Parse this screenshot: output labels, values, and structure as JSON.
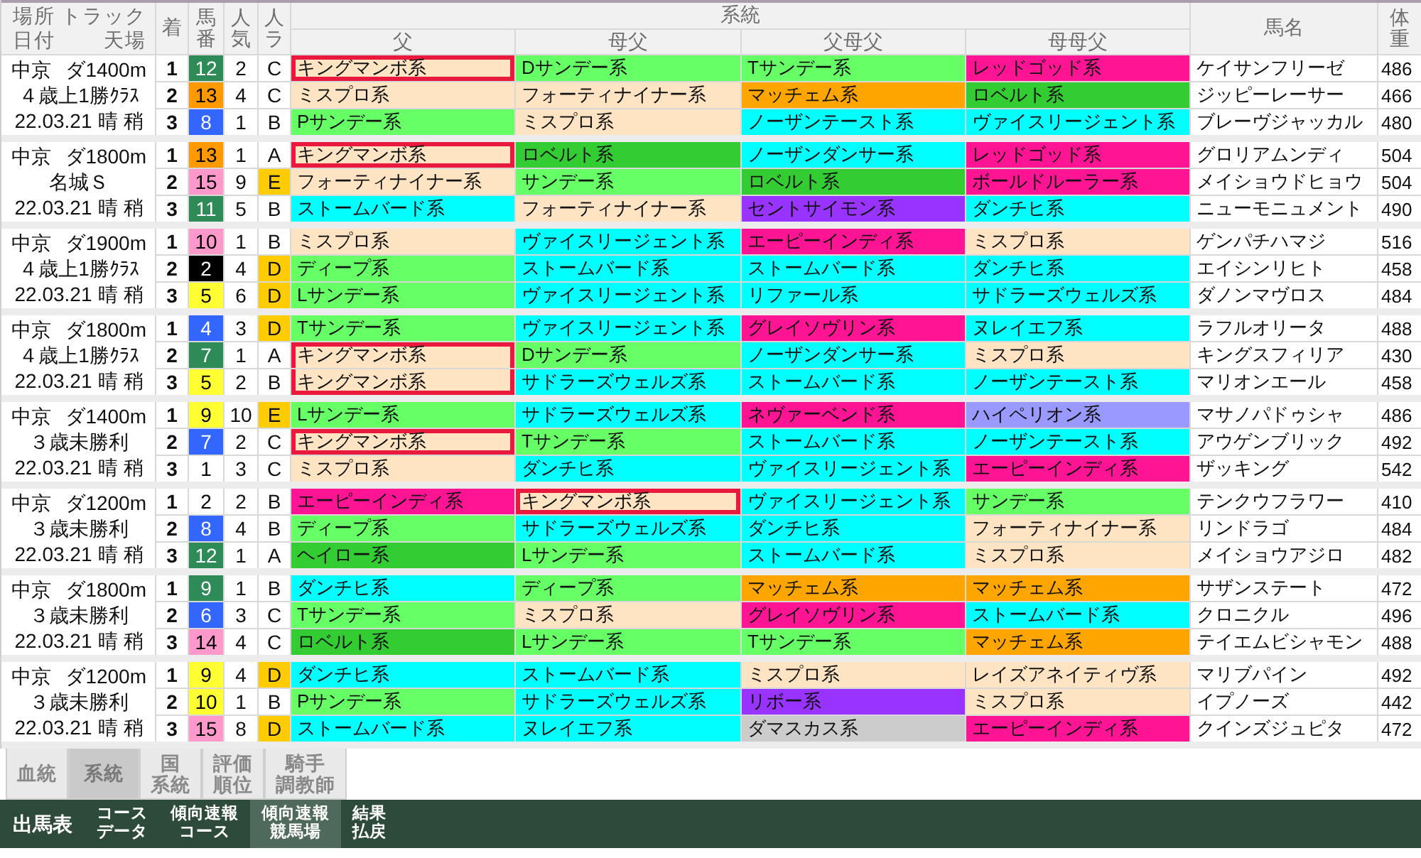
{
  "header": {
    "info_labels": [
      "場所",
      "トラック",
      "日付",
      "天場"
    ],
    "finish": "着",
    "number": "馬番",
    "popularity": "人気",
    "rank": "人ラ",
    "lineage_group": "系統",
    "lineage_columns": [
      "父",
      "母父",
      "父母父",
      "母母父"
    ],
    "horse_name": "馬名",
    "weight": "体重"
  },
  "races": [
    {
      "venue": "中京",
      "track": "ダ1400m",
      "race_name": "４歳上1勝ｸﾗｽ",
      "date": "22.03.21",
      "weather": "晴",
      "going": "稍",
      "horses": [
        {
          "finish": "1",
          "number": {
            "text": "12",
            "color": "#2e8b57"
          },
          "popularity": "2",
          "rank": "C",
          "rank_highlighted": false,
          "lineage": [
            {
              "text": "キングマンボ系",
              "color": "#ffe4c4",
              "marked": true
            },
            {
              "text": "Dサンデー系",
              "color": "#66ff66",
              "marked": false
            },
            {
              "text": "Tサンデー系",
              "color": "#66ff66",
              "marked": false
            },
            {
              "text": "レッドゴッド系",
              "color": "#ff1493",
              "marked": false
            }
          ],
          "name": "ケイサンフリーゼ",
          "weight": "486"
        },
        {
          "finish": "2",
          "number": {
            "text": "13",
            "color": "#ff9900"
          },
          "popularity": "4",
          "rank": "C",
          "rank_highlighted": false,
          "lineage": [
            {
              "text": "ミスプロ系",
              "color": "#ffe4c4",
              "marked": false
            },
            {
              "text": "フォーティナイナー系",
              "color": "#ffe4c4",
              "marked": false
            },
            {
              "text": "マッチェム系",
              "color": "#ffa500",
              "marked": false
            },
            {
              "text": "ロベルト系",
              "color": "#33cc33",
              "marked": false
            }
          ],
          "name": "ジッピーレーサー",
          "weight": "466"
        },
        {
          "finish": "3",
          "number": {
            "text": "8",
            "color": "#3366ff"
          },
          "popularity": "1",
          "rank": "B",
          "rank_highlighted": false,
          "lineage": [
            {
              "text": "Pサンデー系",
              "color": "#66ff66",
              "marked": false
            },
            {
              "text": "ミスプロ系",
              "color": "#ffe4c4",
              "marked": false
            },
            {
              "text": "ノーザンテースト系",
              "color": "#00ffff",
              "marked": false
            },
            {
              "text": "ヴァイスリージェント系",
              "color": "#00ffff",
              "marked": false
            }
          ],
          "name": "ブレーヴジャッカル",
          "weight": "480"
        }
      ]
    },
    {
      "venue": "中京",
      "track": "ダ1800m",
      "race_name": "名城Ｓ",
      "date": "22.03.21",
      "weather": "晴",
      "going": "稍",
      "horses": [
        {
          "finish": "1",
          "number": {
            "text": "13",
            "color": "#ff9900"
          },
          "popularity": "1",
          "rank": "A",
          "rank_highlighted": false,
          "lineage": [
            {
              "text": "キングマンボ系",
              "color": "#ffe4c4",
              "marked": true
            },
            {
              "text": "ロベルト系",
              "color": "#33cc33",
              "marked": false
            },
            {
              "text": "ノーザンダンサー系",
              "color": "#00ffff",
              "marked": false
            },
            {
              "text": "レッドゴッド系",
              "color": "#ff1493",
              "marked": false
            }
          ],
          "name": "グロリアムンディ",
          "weight": "504"
        },
        {
          "finish": "2",
          "number": {
            "text": "15",
            "color": "#ff99cc"
          },
          "popularity": "9",
          "rank": "E",
          "rank_highlighted": true,
          "lineage": [
            {
              "text": "フォーティナイナー系",
              "color": "#ffe4c4",
              "marked": false
            },
            {
              "text": "サンデー系",
              "color": "#66ff66",
              "marked": false
            },
            {
              "text": "ロベルト系",
              "color": "#33cc33",
              "marked": false
            },
            {
              "text": "ボールドルーラー系",
              "color": "#ff1493",
              "marked": false
            }
          ],
          "name": "メイショウドヒョウ",
          "weight": "504"
        },
        {
          "finish": "3",
          "number": {
            "text": "11",
            "color": "#2e8b57"
          },
          "popularity": "5",
          "rank": "B",
          "rank_highlighted": false,
          "lineage": [
            {
              "text": "ストームバード系",
              "color": "#00ffff",
              "marked": false
            },
            {
              "text": "フォーティナイナー系",
              "color": "#ffe4c4",
              "marked": false
            },
            {
              "text": "セントサイモン系",
              "color": "#9933ff",
              "marked": false
            },
            {
              "text": "ダンチヒ系",
              "color": "#00ffff",
              "marked": false
            }
          ],
          "name": "ニューモニュメント",
          "weight": "490"
        }
      ]
    },
    {
      "venue": "中京",
      "track": "ダ1900m",
      "race_name": "４歳上1勝ｸﾗｽ",
      "date": "22.03.21",
      "weather": "晴",
      "going": "稍",
      "horses": [
        {
          "finish": "1",
          "number": {
            "text": "10",
            "color": "#ff99cc"
          },
          "popularity": "1",
          "rank": "B",
          "rank_highlighted": false,
          "lineage": [
            {
              "text": "ミスプロ系",
              "color": "#ffe4c4",
              "marked": false
            },
            {
              "text": "ヴァイスリージェント系",
              "color": "#00ffff",
              "marked": false
            },
            {
              "text": "エーピーインディ系",
              "color": "#ff1493",
              "marked": false
            },
            {
              "text": "ミスプロ系",
              "color": "#ffe4c4",
              "marked": false
            }
          ],
          "name": "ゲンパチハマジ",
          "weight": "516"
        },
        {
          "finish": "2",
          "number": {
            "text": "2",
            "color": "#000000"
          },
          "popularity": "4",
          "rank": "D",
          "rank_highlighted": true,
          "lineage": [
            {
              "text": "ディープ系",
              "color": "#66ff66",
              "marked": false
            },
            {
              "text": "ストームバード系",
              "color": "#00ffff",
              "marked": false
            },
            {
              "text": "ストームバード系",
              "color": "#00ffff",
              "marked": false
            },
            {
              "text": "ダンチヒ系",
              "color": "#00ffff",
              "marked": false
            }
          ],
          "name": "エイシンリヒト",
          "weight": "458"
        },
        {
          "finish": "3",
          "number": {
            "text": "5",
            "color": "#ffff33"
          },
          "popularity": "6",
          "rank": "D",
          "rank_highlighted": true,
          "lineage": [
            {
              "text": "Lサンデー系",
              "color": "#66ff66",
              "marked": false
            },
            {
              "text": "ヴァイスリージェント系",
              "color": "#00ffff",
              "marked": false
            },
            {
              "text": "リファール系",
              "color": "#00ffff",
              "marked": false
            },
            {
              "text": "サドラーズウェルズ系",
              "color": "#00ffff",
              "marked": false
            }
          ],
          "name": "ダノンマヴロス",
          "weight": "484"
        }
      ]
    },
    {
      "venue": "中京",
      "track": "ダ1800m",
      "race_name": "４歳上1勝ｸﾗｽ",
      "date": "22.03.21",
      "weather": "晴",
      "going": "稍",
      "horses": [
        {
          "finish": "1",
          "number": {
            "text": "4",
            "color": "#3366ff"
          },
          "popularity": "3",
          "rank": "D",
          "rank_highlighted": true,
          "lineage": [
            {
              "text": "Tサンデー系",
              "color": "#66ff66",
              "marked": false
            },
            {
              "text": "ヴァイスリージェント系",
              "color": "#00ffff",
              "marked": false
            },
            {
              "text": "グレイソヴリン系",
              "color": "#ff1493",
              "marked": false
            },
            {
              "text": "ヌレイエフ系",
              "color": "#00ffff",
              "marked": false
            }
          ],
          "name": "ラフルオリータ",
          "weight": "488"
        },
        {
          "finish": "2",
          "number": {
            "text": "7",
            "color": "#2e8b57"
          },
          "popularity": "1",
          "rank": "A",
          "rank_highlighted": false,
          "lineage": [
            {
              "text": "キングマンボ系",
              "color": "#ffe4c4",
              "marked": true
            },
            {
              "text": "Dサンデー系",
              "color": "#66ff66",
              "marked": false
            },
            {
              "text": "ノーザンダンサー系",
              "color": "#00ffff",
              "marked": false
            },
            {
              "text": "ミスプロ系",
              "color": "#ffe4c4",
              "marked": false
            }
          ],
          "name": "キングスフィリア",
          "weight": "430"
        },
        {
          "finish": "3",
          "number": {
            "text": "5",
            "color": "#ffff33"
          },
          "popularity": "2",
          "rank": "B",
          "rank_highlighted": false,
          "lineage": [
            {
              "text": "キングマンボ系",
              "color": "#ffe4c4",
              "marked": true
            },
            {
              "text": "サドラーズウェルズ系",
              "color": "#00ffff",
              "marked": false
            },
            {
              "text": "ストームバード系",
              "color": "#00ffff",
              "marked": false
            },
            {
              "text": "ノーザンテースト系",
              "color": "#00ffff",
              "marked": false
            }
          ],
          "name": "マリオンエール",
          "weight": "458"
        }
      ]
    },
    {
      "venue": "中京",
      "track": "ダ1400m",
      "race_name": "３歳未勝利",
      "date": "22.03.21",
      "weather": "晴",
      "going": "稍",
      "horses": [
        {
          "finish": "1",
          "number": {
            "text": "9",
            "color": "#ffff33"
          },
          "popularity": "10",
          "rank": "E",
          "rank_highlighted": true,
          "lineage": [
            {
              "text": "Lサンデー系",
              "color": "#66ff66",
              "marked": false
            },
            {
              "text": "サドラーズウェルズ系",
              "color": "#00ffff",
              "marked": false
            },
            {
              "text": "ネヴァーベンド系",
              "color": "#ff1493",
              "marked": false
            },
            {
              "text": "ハイペリオン系",
              "color": "#9999ff",
              "marked": false
            }
          ],
          "name": "マサノパドゥシャ",
          "weight": "486"
        },
        {
          "finish": "2",
          "number": {
            "text": "7",
            "color": "#3366ff"
          },
          "popularity": "2",
          "rank": "C",
          "rank_highlighted": false,
          "lineage": [
            {
              "text": "キングマンボ系",
              "color": "#ffe4c4",
              "marked": true
            },
            {
              "text": "Tサンデー系",
              "color": "#66ff66",
              "marked": false
            },
            {
              "text": "ストームバード系",
              "color": "#00ffff",
              "marked": false
            },
            {
              "text": "ノーザンテースト系",
              "color": "#00ffff",
              "marked": false
            }
          ],
          "name": "アウゲンブリック",
          "weight": "492"
        },
        {
          "finish": "3",
          "number": {
            "text": "1",
            "color": "#ffffff"
          },
          "popularity": "3",
          "rank": "C",
          "rank_highlighted": false,
          "lineage": [
            {
              "text": "ミスプロ系",
              "color": "#ffe4c4",
              "marked": false
            },
            {
              "text": "ダンチヒ系",
              "color": "#00ffff",
              "marked": false
            },
            {
              "text": "ヴァイスリージェント系",
              "color": "#00ffff",
              "marked": false
            },
            {
              "text": "エーピーインディ系",
              "color": "#ff1493",
              "marked": false
            }
          ],
          "name": "ザッキング",
          "weight": "542"
        }
      ]
    },
    {
      "venue": "中京",
      "track": "ダ1200m",
      "race_name": "３歳未勝利",
      "date": "22.03.21",
      "weather": "晴",
      "going": "稍",
      "horses": [
        {
          "finish": "1",
          "number": {
            "text": "2",
            "color": "#ffffff"
          },
          "popularity": "2",
          "rank": "B",
          "rank_highlighted": false,
          "lineage": [
            {
              "text": "エーピーインディ系",
              "color": "#ff1493",
              "marked": false
            },
            {
              "text": "キングマンボ系",
              "color": "#ffe4c4",
              "marked": true
            },
            {
              "text": "ヴァイスリージェント系",
              "color": "#00ffff",
              "marked": false
            },
            {
              "text": "サンデー系",
              "color": "#66ff66",
              "marked": false
            }
          ],
          "name": "テンクウフラワー",
          "weight": "410"
        },
        {
          "finish": "2",
          "number": {
            "text": "8",
            "color": "#3366ff"
          },
          "popularity": "4",
          "rank": "B",
          "rank_highlighted": false,
          "lineage": [
            {
              "text": "ディープ系",
              "color": "#66ff66",
              "marked": false
            },
            {
              "text": "サドラーズウェルズ系",
              "color": "#00ffff",
              "marked": false
            },
            {
              "text": "ダンチヒ系",
              "color": "#00ffff",
              "marked": false
            },
            {
              "text": "フォーティナイナー系",
              "color": "#ffe4c4",
              "marked": false
            }
          ],
          "name": "リンドラゴ",
          "weight": "484"
        },
        {
          "finish": "3",
          "number": {
            "text": "12",
            "color": "#2e8b57"
          },
          "popularity": "1",
          "rank": "A",
          "rank_highlighted": false,
          "lineage": [
            {
              "text": "ヘイロー系",
              "color": "#33cc33",
              "marked": false
            },
            {
              "text": "Lサンデー系",
              "color": "#66ff66",
              "marked": false
            },
            {
              "text": "ストームバード系",
              "color": "#00ffff",
              "marked": false
            },
            {
              "text": "ミスプロ系",
              "color": "#ffe4c4",
              "marked": false
            }
          ],
          "name": "メイショウアジロ",
          "weight": "482"
        }
      ]
    },
    {
      "venue": "中京",
      "track": "ダ1800m",
      "race_name": "３歳未勝利",
      "date": "22.03.21",
      "weather": "晴",
      "going": "稍",
      "horses": [
        {
          "finish": "1",
          "number": {
            "text": "9",
            "color": "#2e8b57"
          },
          "popularity": "1",
          "rank": "B",
          "rank_highlighted": false,
          "lineage": [
            {
              "text": "ダンチヒ系",
              "color": "#00ffff",
              "marked": false
            },
            {
              "text": "ディープ系",
              "color": "#66ff66",
              "marked": false
            },
            {
              "text": "マッチェム系",
              "color": "#ffa500",
              "marked": false
            },
            {
              "text": "マッチェム系",
              "color": "#ffa500",
              "marked": false
            }
          ],
          "name": "サザンステート",
          "weight": "472"
        },
        {
          "finish": "2",
          "number": {
            "text": "6",
            "color": "#3366ff"
          },
          "popularity": "3",
          "rank": "C",
          "rank_highlighted": false,
          "lineage": [
            {
              "text": "Tサンデー系",
              "color": "#66ff66",
              "marked": false
            },
            {
              "text": "ミスプロ系",
              "color": "#ffe4c4",
              "marked": false
            },
            {
              "text": "グレイソヴリン系",
              "color": "#ff1493",
              "marked": false
            },
            {
              "text": "ストームバード系",
              "color": "#00ffff",
              "marked": false
            }
          ],
          "name": "クロニクル",
          "weight": "496"
        },
        {
          "finish": "3",
          "number": {
            "text": "14",
            "color": "#ff99cc"
          },
          "popularity": "4",
          "rank": "C",
          "rank_highlighted": false,
          "lineage": [
            {
              "text": "ロベルト系",
              "color": "#33cc33",
              "marked": false
            },
            {
              "text": "Lサンデー系",
              "color": "#66ff66",
              "marked": false
            },
            {
              "text": "Tサンデー系",
              "color": "#66ff66",
              "marked": false
            },
            {
              "text": "マッチェム系",
              "color": "#ffa500",
              "marked": false
            }
          ],
          "name": "テイエムビシャモン",
          "weight": "488"
        }
      ]
    },
    {
      "venue": "中京",
      "track": "ダ1200m",
      "race_name": "３歳未勝利",
      "date": "22.03.21",
      "weather": "晴",
      "going": "稍",
      "horses": [
        {
          "finish": "1",
          "number": {
            "text": "9",
            "color": "#ffff33"
          },
          "popularity": "4",
          "rank": "D",
          "rank_highlighted": true,
          "lineage": [
            {
              "text": "ダンチヒ系",
              "color": "#00ffff",
              "marked": false
            },
            {
              "text": "ストームバード系",
              "color": "#00ffff",
              "marked": false
            },
            {
              "text": "ミスプロ系",
              "color": "#ffe4c4",
              "marked": false
            },
            {
              "text": "レイズアネイティヴ系",
              "color": "#ffe4c4",
              "marked": false
            }
          ],
          "name": "マリブパイン",
          "weight": "492"
        },
        {
          "finish": "2",
          "number": {
            "text": "10",
            "color": "#ffff33"
          },
          "popularity": "1",
          "rank": "B",
          "rank_highlighted": false,
          "lineage": [
            {
              "text": "Pサンデー系",
              "color": "#66ff66",
              "marked": false
            },
            {
              "text": "サドラーズウェルズ系",
              "color": "#00ffff",
              "marked": false
            },
            {
              "text": "リボー系",
              "color": "#9933ff",
              "marked": false
            },
            {
              "text": "ミスプロ系",
              "color": "#ffe4c4",
              "marked": false
            }
          ],
          "name": "イプノーズ",
          "weight": "442"
        },
        {
          "finish": "3",
          "number": {
            "text": "15",
            "color": "#ff99cc"
          },
          "popularity": "8",
          "rank": "D",
          "rank_highlighted": true,
          "lineage": [
            {
              "text": "ストームバード系",
              "color": "#00ffff",
              "marked": false
            },
            {
              "text": "ヌレイエフ系",
              "color": "#00ffff",
              "marked": false
            },
            {
              "text": "ダマスカス系",
              "color": "#cccccc",
              "marked": false
            },
            {
              "text": "エーピーインディ系",
              "color": "#ff1493",
              "marked": false
            }
          ],
          "name": "クインズジュピタ",
          "weight": "472"
        }
      ]
    }
  ],
  "view_tabs": [
    {
      "lines": [
        "血統"
      ],
      "selected": false
    },
    {
      "lines": [
        "系統"
      ],
      "selected": true
    },
    {
      "lines": [
        "国",
        "系統"
      ],
      "selected": false
    },
    {
      "lines": [
        "評価",
        "順位"
      ],
      "selected": false
    },
    {
      "lines": [
        "騎手",
        "調教師"
      ],
      "selected": false
    }
  ],
  "nav": [
    {
      "lines": [
        "出馬表"
      ],
      "selected": false
    },
    {
      "lines": [
        "コース",
        "データ"
      ],
      "selected": false
    },
    {
      "lines": [
        "傾向速報",
        "コース"
      ],
      "selected": false
    },
    {
      "lines": [
        "傾向速報",
        "競馬場"
      ],
      "selected": true
    },
    {
      "lines": [
        "結果",
        "払戻"
      ],
      "selected": false
    }
  ]
}
